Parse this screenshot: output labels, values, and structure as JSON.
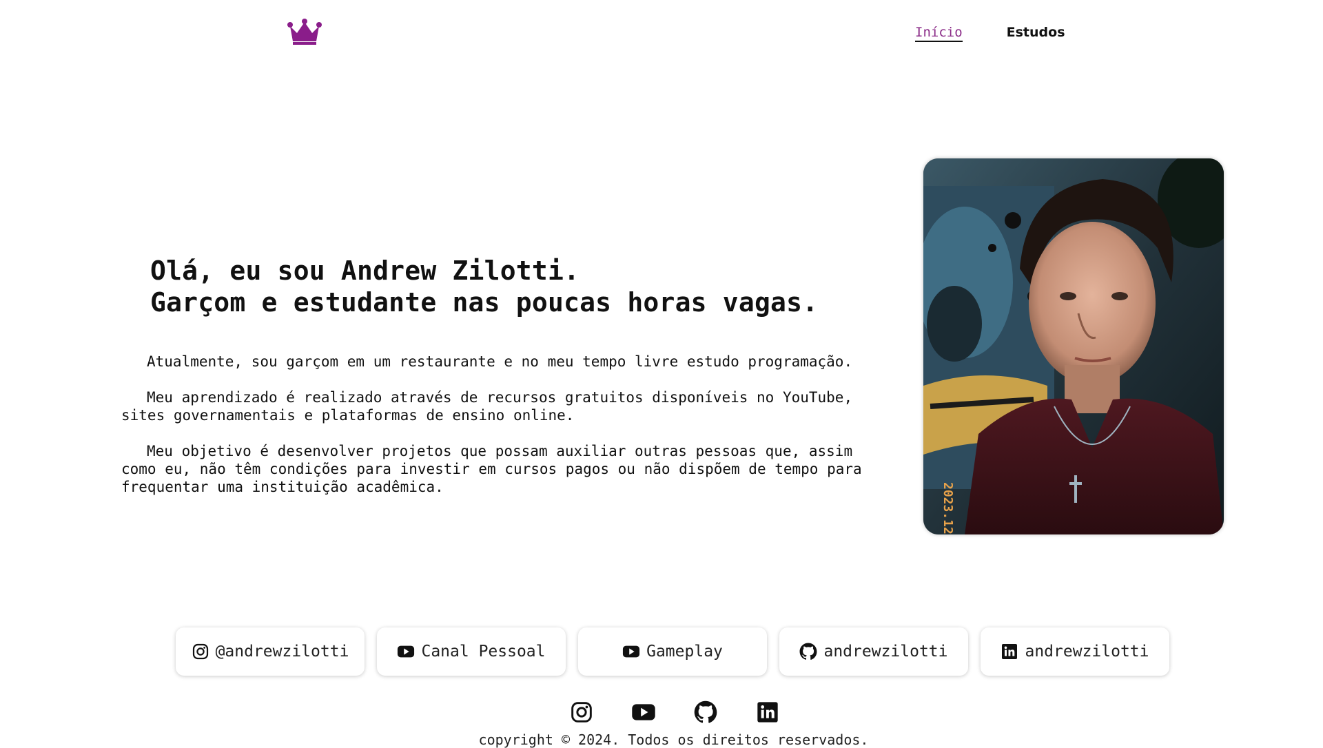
{
  "header": {
    "logo_icon": "crown-icon",
    "logo_color": "#8a1d8a",
    "nav": [
      {
        "label": "Início",
        "active": true
      },
      {
        "label": "Estudos",
        "active": false
      }
    ]
  },
  "hero": {
    "title_line1": "Olá, eu sou Andrew Zilotti.",
    "title_line2": "Garçom e estudante nas poucas horas vagas.",
    "paragraphs": [
      "Atualmente, sou garçom em um restaurante e no meu tempo livre estudo programação.",
      "Meu aprendizado é realizado através de recursos gratuitos disponíveis no YouTube,\nsites governamentais e plataformas de ensino online.",
      "Meu objetivo é desenvolver projetos que possam auxiliar outras pessoas que, assim\ncomo eu, não têm condições para investir em cursos pagos ou não dispõem de tempo para\nfrequentar uma instituição acadêmica."
    ],
    "photo_stamp": "2023.12"
  },
  "social_buttons": [
    {
      "icon": "instagram-icon",
      "label": "@andrewzilotti"
    },
    {
      "icon": "youtube-icon",
      "label": "Canal Pessoal"
    },
    {
      "icon": "youtube-icon",
      "label": "Gameplay"
    },
    {
      "icon": "github-icon",
      "label": "andrewzilotti"
    },
    {
      "icon": "linkedin-icon",
      "label": "andrewzilotti"
    }
  ],
  "footer": {
    "icons": [
      "instagram-icon",
      "youtube-icon",
      "github-icon",
      "linkedin-icon"
    ],
    "copyright": "copyright © 2024. Todos os direitos reservados."
  }
}
